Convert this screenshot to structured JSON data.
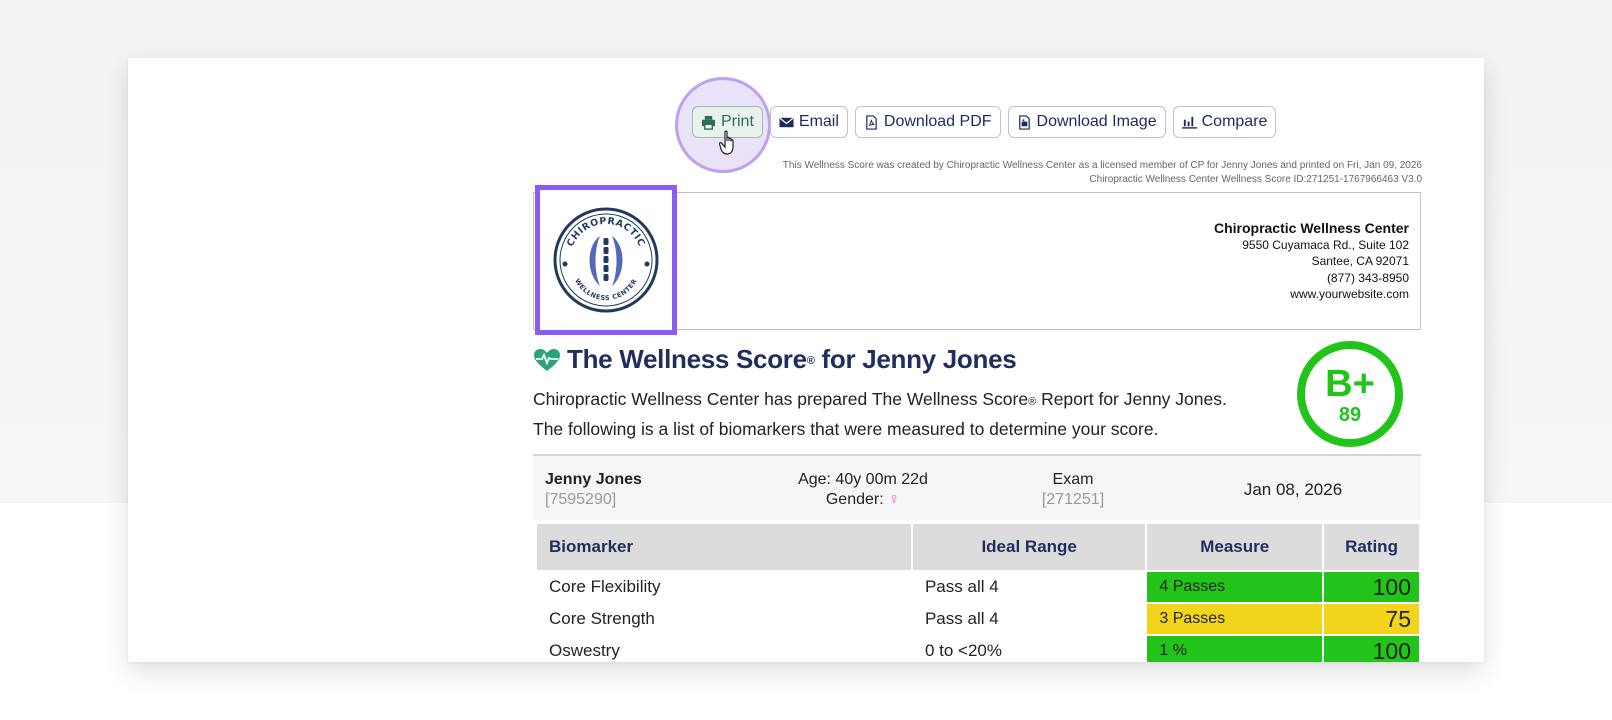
{
  "toolbar": {
    "print": "Print",
    "email": "Email",
    "download_pdf": "Download PDF",
    "download_image": "Download Image",
    "compare": "Compare"
  },
  "fineprint": {
    "line1": "This Wellness Score was created by Chiropractic Wellness Center as a licensed member of CP for Jenny Jones and printed on Fri, Jan 09, 2026",
    "line2": "Chiropractic Wellness Center Wellness Score ID:271251-1767966463 V3.0"
  },
  "logo": {
    "top_text": "CHIROPRACTIC",
    "bottom_text": "WELLNESS CENTER"
  },
  "clinic": {
    "name": "Chiropractic Wellness Center",
    "address": "9550 Cuyamaca Rd., Suite 102",
    "city": "Santee, CA 92071",
    "phone": "(877) 343-8950",
    "website": "www.yourwebsite.com"
  },
  "report": {
    "title_prefix": "The Wellness Score",
    "title_suffix": " for Jenny Jones",
    "reg": "®",
    "desc_a": "Chiropractic Wellness Center has prepared The Wellness Score",
    "desc_b": " Report for Jenny Jones.",
    "desc_line2": "The following is a list of biomarkers that were measured to determine your score."
  },
  "grade": {
    "letter": "B+",
    "score": "89",
    "color": "#22c41a"
  },
  "patient": {
    "name": "Jenny Jones",
    "id": "[7595290]",
    "age": "Age: 40y 00m 22d",
    "gender_label": "Gender:",
    "gender_symbol": "♀",
    "exam_label": "Exam",
    "exam_id": "[271251]",
    "date": "Jan 08, 2026"
  },
  "table": {
    "headers": [
      "Biomarker",
      "Ideal Range",
      "Measure",
      "Rating"
    ],
    "rows": [
      {
        "biomarker": "Core Flexibility",
        "range": "Pass all 4",
        "measure": "4 Passes",
        "rating": "100",
        "status": "green"
      },
      {
        "biomarker": "Core Strength",
        "range": "Pass all 4",
        "measure": "3 Passes",
        "rating": "75",
        "status": "yellow"
      },
      {
        "biomarker": "Oswestry",
        "range": "0 to <20%",
        "measure": "1 %",
        "rating": "100",
        "status": "green"
      }
    ]
  },
  "colors": {
    "accent": "#8a5cf0",
    "title": "#1f2e5e",
    "green": "#22c41a",
    "yellow": "#f2d51b"
  }
}
